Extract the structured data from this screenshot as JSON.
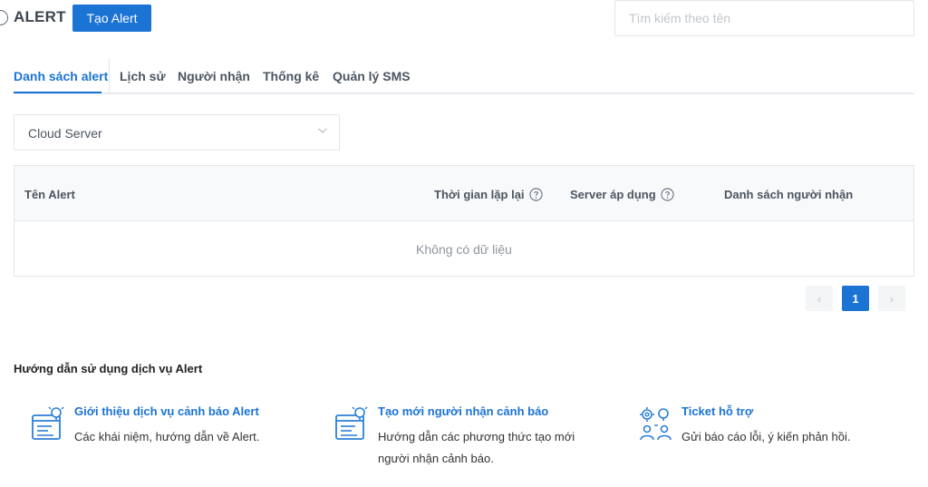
{
  "header": {
    "title": "ALERT",
    "create_button": "Tạo Alert",
    "search_placeholder": "Tìm kiếm theo tên"
  },
  "tabs": [
    {
      "label": "Danh sách alert",
      "active": true
    },
    {
      "label": "Lịch sử",
      "active": false
    },
    {
      "label": "Người nhận",
      "active": false
    },
    {
      "label": "Thống kê",
      "active": false
    },
    {
      "label": "Quản lý SMS",
      "active": false
    }
  ],
  "filter": {
    "selected": "Cloud Server"
  },
  "table": {
    "columns": [
      "Tên Alert",
      "Thời gian lặp lại",
      "Server áp dụng",
      "Danh sách người nhận"
    ],
    "empty_text": "Không có dữ liệu"
  },
  "pagination": {
    "prev": "‹",
    "current": "1",
    "next": "›"
  },
  "guide": {
    "title": "Hướng dẫn sử dụng dịch vụ Alert",
    "cards": [
      {
        "title": "Giới thiệu dịch vụ cảnh báo Alert",
        "desc_line1": "Các khái niệm, hướng dẫn về Alert.",
        "desc_line2": "",
        "icon": "document-bulb-icon"
      },
      {
        "title": "Tạo mới người nhận cảnh báo",
        "desc_line1": "Hướng dẫn các phương thức tạo mới",
        "desc_line2": "người nhận cảnh báo.",
        "icon": "document-bulb-icon"
      },
      {
        "title": "Ticket hỗ trợ",
        "desc_line1": "Gửi báo cáo lỗi, ý kiến phản hồi.",
        "desc_line2": "",
        "icon": "gear-people-icon"
      }
    ]
  },
  "colors": {
    "accent": "#1b73d4",
    "text": "#4b5560",
    "border": "#e3e6ea"
  }
}
